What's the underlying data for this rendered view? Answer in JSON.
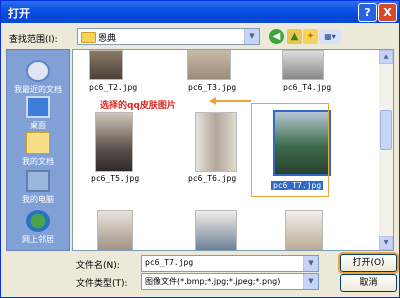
{
  "window": {
    "title": "打开"
  },
  "titlebar": {
    "help_label": "?",
    "close_label": "X"
  },
  "toolbar": {
    "lookin_label": "查找范围(I):",
    "lookin_value": "恩典"
  },
  "places": [
    {
      "label": "我最近的文档"
    },
    {
      "label": "桌面"
    },
    {
      "label": "我的文档"
    },
    {
      "label": "我的电脑"
    },
    {
      "label": "网上邻居"
    }
  ],
  "files": [
    {
      "name": "pc6_T2.jpg"
    },
    {
      "name": "pc6_T3.jpg"
    },
    {
      "name": "pc6_T4.jpg"
    },
    {
      "name": "pc6_T5.jpg"
    },
    {
      "name": "pc6_T6.jpg"
    },
    {
      "name": "pc6_T7.jpg",
      "selected": true
    }
  ],
  "annotation": {
    "text": "选择的qq皮肤图片",
    "color": "#d8261c"
  },
  "form": {
    "filename_label": "文件名(N):",
    "filename_value": "pc6_T7.jpg",
    "filetype_label": "文件类型(T):",
    "filetype_value": "图像文件(*.bmp;*.jpg;*.jpeg;*.png)",
    "open_label": "打开(O)",
    "cancel_label": "取消"
  },
  "colors": {
    "titlebar": "#0a54e3",
    "highlight": "#f0a23a",
    "selection": "#316ac5"
  }
}
